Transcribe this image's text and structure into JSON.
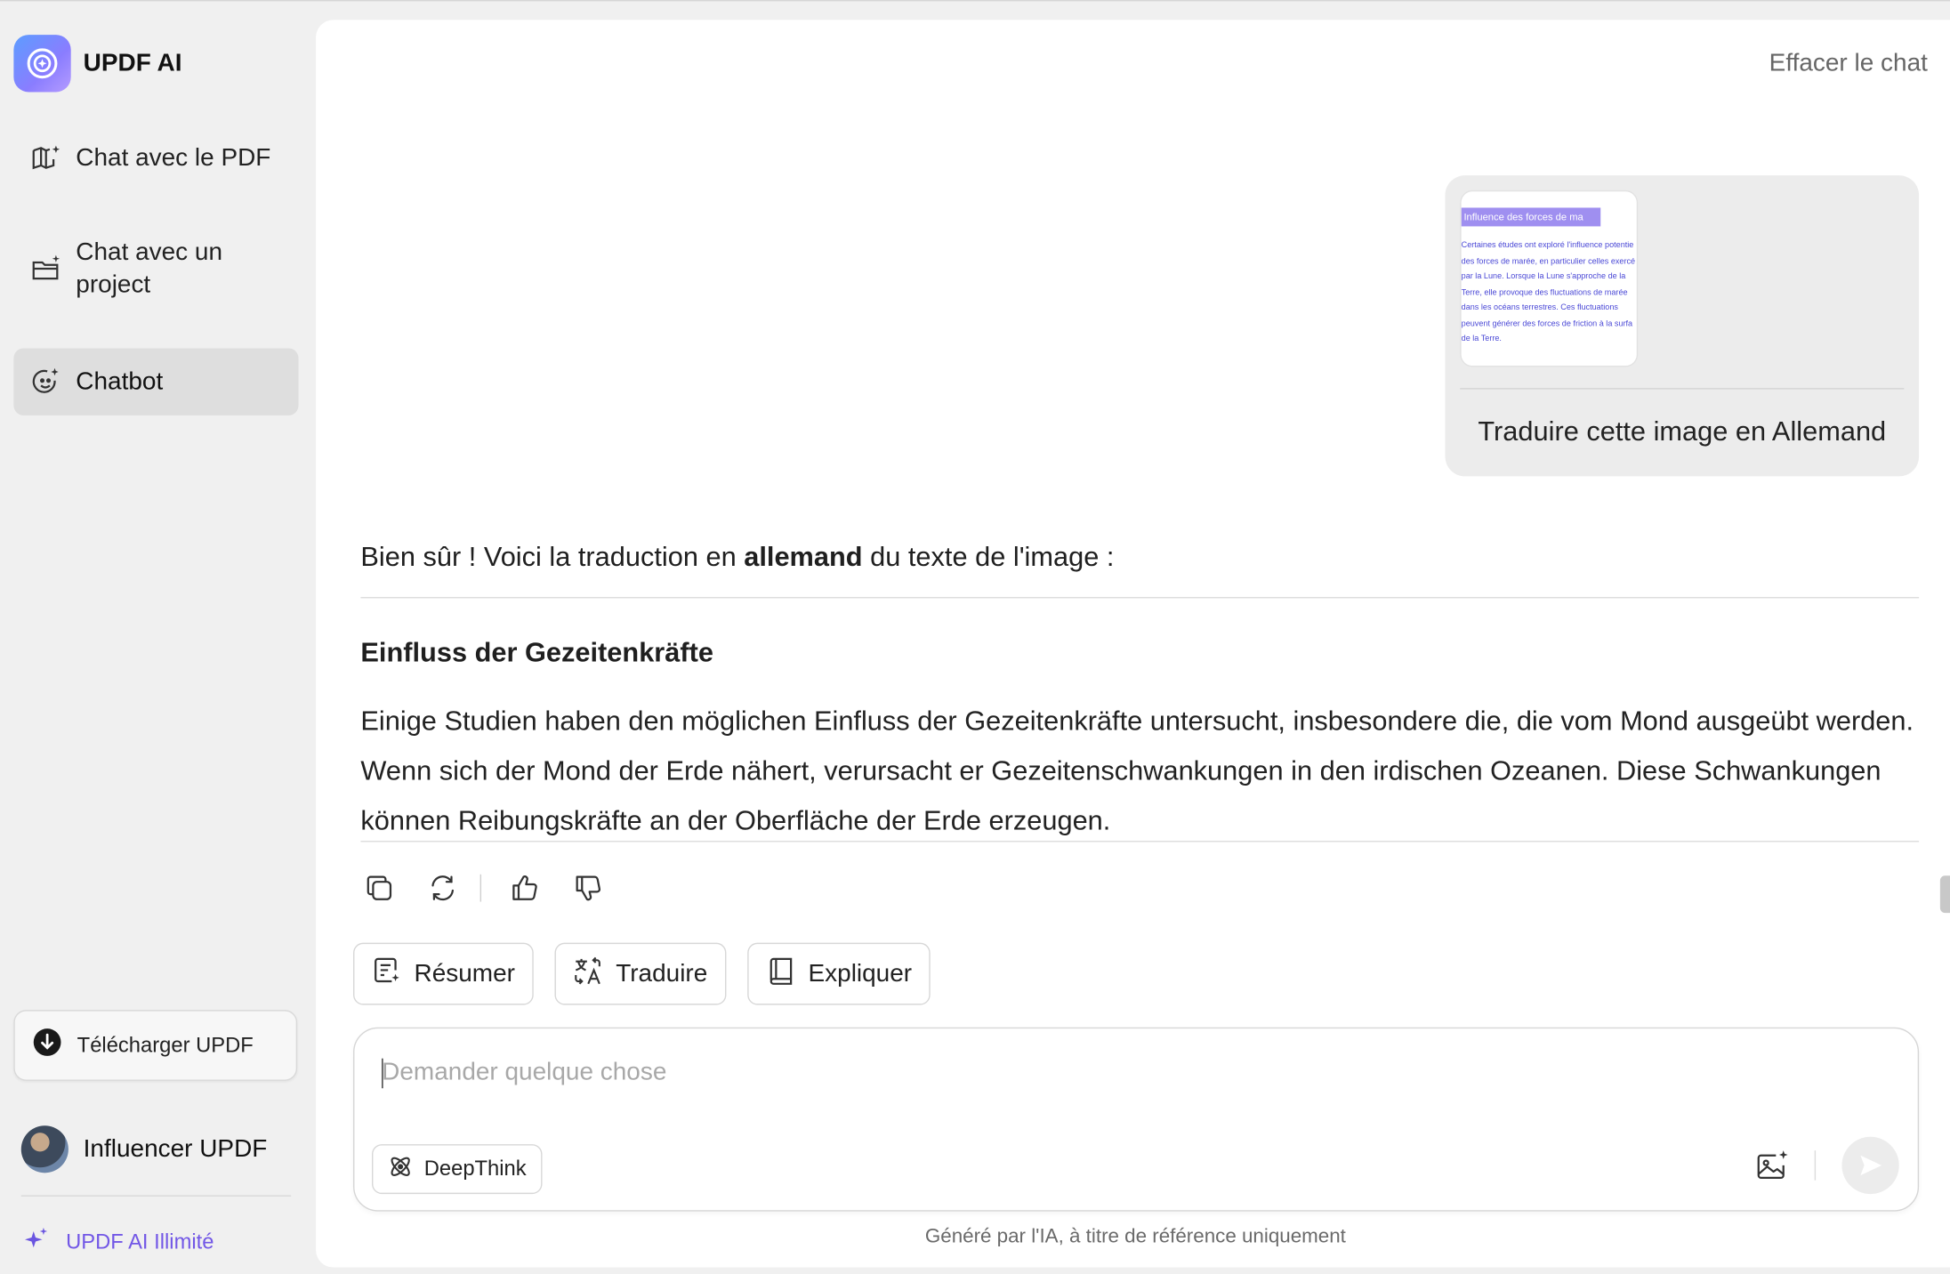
{
  "brand": {
    "name": "UPDF AI",
    "logo_icon": "updf-ai-logo-icon"
  },
  "sidebar": {
    "items": [
      {
        "label": "Chat avec le PDF",
        "icon": "book-spark-icon"
      },
      {
        "label": "Chat avec un project",
        "icon": "folder-spark-icon"
      },
      {
        "label": "Chatbot",
        "icon": "bot-face-icon",
        "active": true
      }
    ],
    "download_label": "Télécharger UPDF",
    "user_name": "Influencer UPDF",
    "upgrade_label": "UPDF AI Illimité"
  },
  "header": {
    "clear_chat": "Effacer le chat"
  },
  "user_message": {
    "text": "Traduire cette image en Allemand",
    "attachment": {
      "title": "Influence des forces de ma",
      "lines": [
        "Certaines études ont exploré l'influence potentie",
        "des forces de marée, en particulier celles exercé",
        "par la Lune. Lorsque la Lune s'approche de la",
        "Terre, elle provoque des fluctuations de marée",
        "dans les océans terrestres. Ces fluctuations",
        "peuvent générer des forces de friction à la surfa",
        "de la Terre."
      ]
    }
  },
  "answer": {
    "intro_before": "Bien sûr ! Voici la traduction en ",
    "intro_bold": "allemand",
    "intro_after": " du texte de l'image :",
    "title": "Einfluss der Gezeitenkräfte",
    "body": "Einige Studien haben den möglichen Einfluss der Gezeitenkräfte untersucht, insbesondere die, die vom Mond ausgeübt werden. Wenn sich der Mond der Erde nähert, verursacht er Gezeitenschwankungen in den irdischen Ozeanen. Diese Schwankungen können Reibungskräfte an der Oberfläche der Erde erzeugen."
  },
  "quick_actions": [
    {
      "label": "Résumer",
      "icon": "summarize-icon"
    },
    {
      "label": "Traduire",
      "icon": "translate-icon"
    },
    {
      "label": "Expliquer",
      "icon": "book-icon"
    }
  ],
  "composer": {
    "placeholder": "Demander quelque chose",
    "value": "",
    "deepthink_label": "DeepThink"
  },
  "footer": {
    "disclaimer": "Généré par l'IA, à titre de référence uniquement"
  },
  "colors": {
    "accent": "#7257e6",
    "active_nav": "#dedede",
    "bubble": "#ececec"
  }
}
